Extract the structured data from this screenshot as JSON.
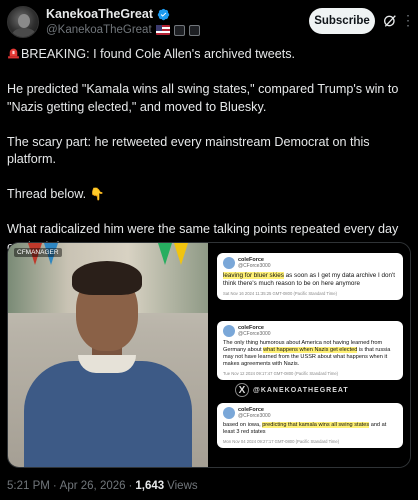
{
  "author": {
    "display_name": "KanekoaTheGreat",
    "handle": "@KanekoaTheGreat",
    "verified_color": "#1d9bf0",
    "subscribe_label": "Subscribe"
  },
  "tweet": {
    "p1": "BREAKING: I found Cole Allen's archived tweets.",
    "p2": "He predicted \"Kamala wins all swing states,\" compared Trump's win to \"Nazis getting elected,\" and moved to Bluesky.",
    "p3": "The scary part: he retweeted every mainstream Democrat on this platform.",
    "p4": "Thread below.",
    "p5": "What radicalized him were the same talking points repeated every day on the left."
  },
  "media": {
    "photo_tag": "CFMANAGER",
    "cards": [
      {
        "name": "coleForce",
        "handle": "@CForce3000",
        "highlight": "leaving for bluer skies",
        "text": " as soon as I get my data archive I don't think there's much reason to be on here anymore",
        "meta": "Sat Nov 16 2024 11:35:25 GMT-0800 (Pacific Standard Time)"
      },
      {
        "name": "coleForce",
        "handle": "@CForce3000",
        "pre": "The only thing humorous about America not having learned from Germany about ",
        "highlight": "what happens when Nazis get elected",
        "text": " is that russia may not have learned from the USSR about what happens when it makes agreements with Nazis.",
        "meta": "Tue Nov 12 2024 09:17:47 GMT-0800 (Pacific Standard Time)"
      },
      {
        "name": "coleForce",
        "handle": "@CForce3000",
        "pre": "based on iowa, ",
        "highlight": "predicting that kamala wins all swing states",
        "text": " and at least 3 red states",
        "meta": "Mon Nov 04 2024 09:27:17 GMT-0800 (Pacific Standard Time)"
      }
    ],
    "watermark": "@KANEKOATHEGREAT"
  },
  "footer": {
    "time": "5:21 PM",
    "dot": "·",
    "date": "Apr 26, 2026",
    "views_count": "1,643",
    "views_label": "Views"
  },
  "icons": {
    "verified": "verified-badge-icon",
    "grok": "grok-icon",
    "more": "more-icon",
    "siren": "siren-icon",
    "pointing": "pointing-down-icon"
  }
}
